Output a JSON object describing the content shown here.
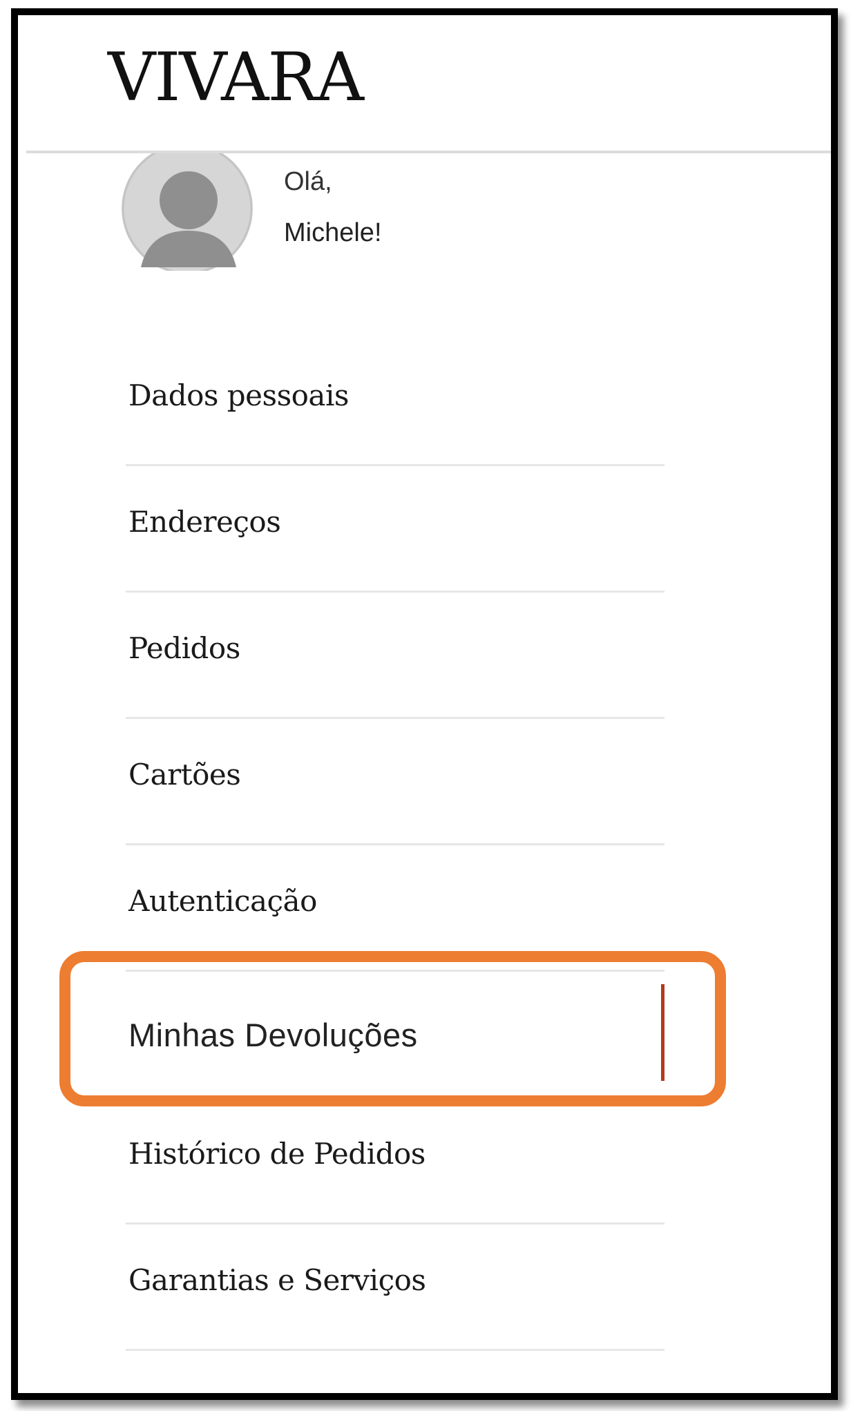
{
  "header": {
    "logo_text": "VIVARA"
  },
  "profile": {
    "avatar_icon": "user-avatar-icon",
    "greeting": "Olá,",
    "name": "Michele!"
  },
  "menu": {
    "items": [
      {
        "label": "Dados pessoais",
        "active": false
      },
      {
        "label": "Endereços",
        "active": false
      },
      {
        "label": "Pedidos",
        "active": false
      },
      {
        "label": "Cartões",
        "active": false
      },
      {
        "label": "Autenticação",
        "active": false
      },
      {
        "label": "Minhas Devoluções",
        "active": true
      },
      {
        "label": "Histórico de Pedidos",
        "active": false
      },
      {
        "label": "Garantias e Serviços",
        "active": false
      }
    ]
  },
  "colors": {
    "active_indicator": "#b5381e",
    "highlight_outline": "#ed7d31",
    "frame_border": "#000000"
  }
}
